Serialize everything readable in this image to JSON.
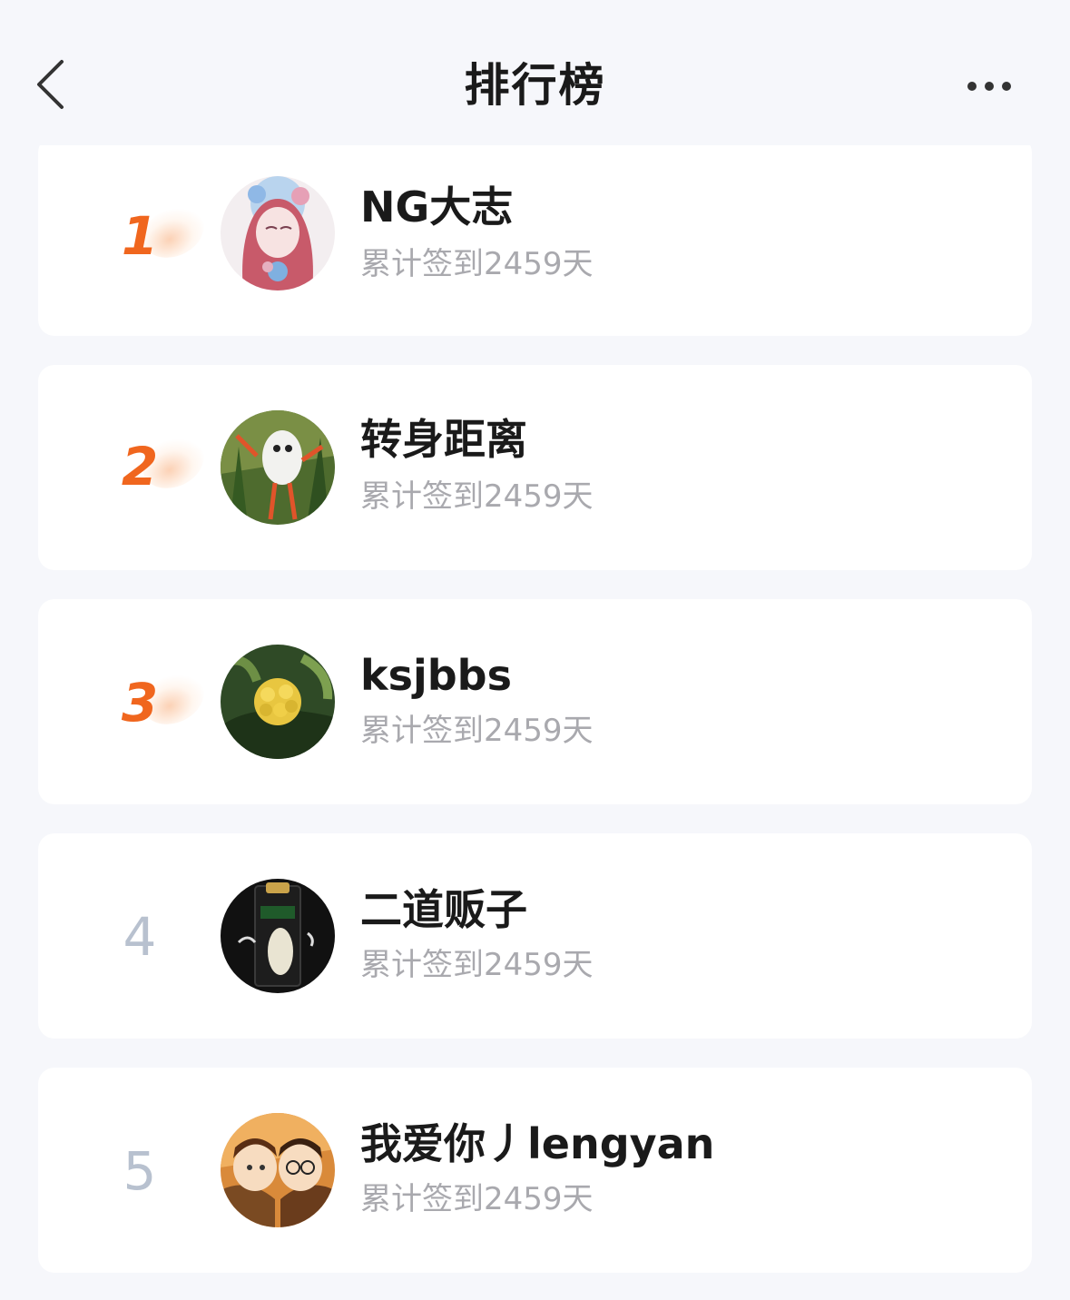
{
  "header": {
    "title": "排行榜",
    "back_icon": "chevron-left-icon",
    "more_icon": "more-dots-icon"
  },
  "colors": {
    "accent": "#f0661e",
    "rank_normal": "#b8c1cf",
    "background": "#f6f7fb",
    "card": "#ffffff",
    "meta_text": "#a9a9ae"
  },
  "ranking": [
    {
      "rank": "1",
      "name": "NG大志",
      "checkin": "累计签到2459天",
      "highlight": true
    },
    {
      "rank": "2",
      "name": "转身距离",
      "checkin": "累计签到2459天",
      "highlight": true
    },
    {
      "rank": "3",
      "name": "ksjbbs",
      "checkin": "累计签到2459天",
      "highlight": true
    },
    {
      "rank": "4",
      "name": "二道贩子",
      "checkin": "累计签到2459天",
      "highlight": false
    },
    {
      "rank": "5",
      "name": "我爱你丿lengyan",
      "checkin": "累计签到2459天",
      "highlight": false
    }
  ]
}
